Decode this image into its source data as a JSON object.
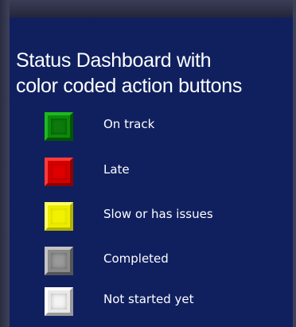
{
  "title": "Status Dashboard with\ncolor coded action buttons",
  "legend": [
    {
      "label": "On track",
      "color": "#0a8a0a",
      "icon": "green-button-icon"
    },
    {
      "label": "Late",
      "color": "#d40000",
      "icon": "red-button-icon"
    },
    {
      "label": "Slow or has issues",
      "color": "#ecec00",
      "icon": "yellow-button-icon"
    },
    {
      "label": "Completed",
      "color": "#8a8a8a",
      "icon": "gray-button-icon"
    },
    {
      "label": "Not started yet",
      "color": "#e8e8e8",
      "icon": "white-button-icon"
    }
  ],
  "colors": {
    "panel_background": "#10205f",
    "text": "#ffffff"
  }
}
